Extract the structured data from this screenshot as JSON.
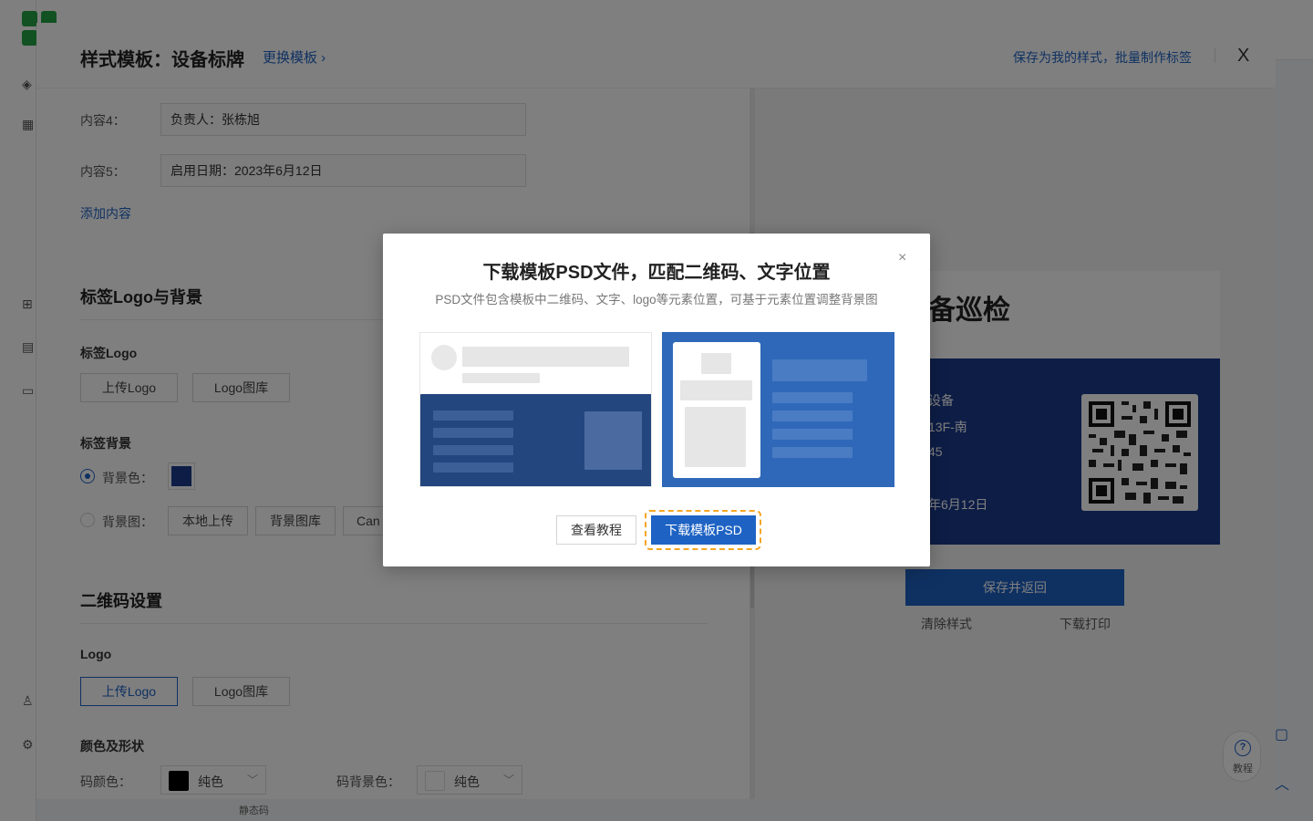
{
  "colors": {
    "accent": "#1e63c4",
    "label_bg": "#1a3a8c",
    "highlight": "#f5a623",
    "illus_dark": "#23467f",
    "illus_light": "#2f68b8"
  },
  "background": {
    "bottom_hint": "静态码"
  },
  "panel": {
    "title": "样式模板：设备标牌",
    "switch_template": "更换模板 ›",
    "save_my_style": "保存为我的样式，批量制作标签",
    "close": "X"
  },
  "content_fields": [
    {
      "label": "内容4：",
      "value": "负责人：张栋旭"
    },
    {
      "label": "内容5：",
      "value": "启用日期：2023年6月12日"
    }
  ],
  "add_content": "添加内容",
  "logo_bg_section": {
    "title": "标签Logo与背景",
    "label_logo_title": "标签Logo",
    "upload_logo": "上传Logo",
    "logo_library": "Logo图库",
    "label_bg_title": "标签背景",
    "bg_color_label": "背景色：",
    "bg_image_label": "背景图：",
    "local_upload": "本地上传",
    "bg_library": "背景图库",
    "canva_partial": "Can"
  },
  "qr_section": {
    "title": "二维码设置",
    "logo_title": "Logo",
    "upload_logo": "上传Logo",
    "logo_library": "Logo图库",
    "color_shape_title": "颜色及形状",
    "code_color_label": "码颜色：",
    "code_color_value": "纯色",
    "code_bg_label": "码背景色：",
    "code_bg_value": "纯色"
  },
  "preview": {
    "title_partial": "备巡检",
    "lines": [
      "设备",
      "13F-南",
      "45",
      "年6月12日"
    ],
    "save_return": "保存并返回",
    "clear_style": "清除样式",
    "download_print": "下载打印",
    "help": "教程"
  },
  "modal": {
    "title": "下载模板PSD文件，匹配二维码、文字位置",
    "subtitle": "PSD文件包含模板中二维码、文字、logo等元素位置，可基于元素位置调整背景图",
    "view_tutorial": "查看教程",
    "download_psd": "下载模板PSD",
    "close": "×"
  }
}
